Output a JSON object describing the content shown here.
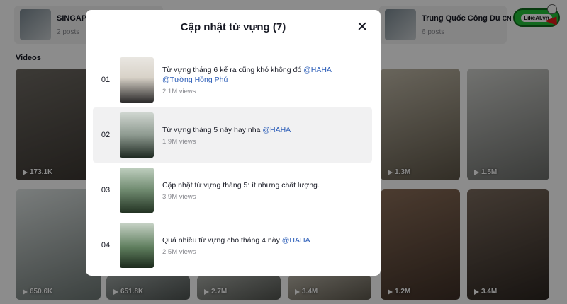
{
  "background": {
    "playlists": [
      {
        "name": "SINGAPO",
        "suffix": "",
        "count": "2 posts"
      },
      {
        "name": "Trung Quốc Công Du",
        "suffix": "CN",
        "count": "6 posts"
      }
    ],
    "logo_text": "LikeAI.vn",
    "videos_heading": "Videos",
    "videos": [
      {
        "views": "173.1K"
      },
      {
        "views": "1.3M"
      },
      {
        "views": "1.5M"
      },
      {
        "views": "650.6K"
      },
      {
        "views": "651.8K"
      },
      {
        "views": "2.7M"
      },
      {
        "views": "3.4M"
      },
      {
        "views": "1.2M"
      },
      {
        "views": "3.4M"
      }
    ]
  },
  "modal": {
    "title": "Cập nhật từ vựng (7)",
    "items": [
      {
        "index": "01",
        "title": "Từ vựng tháng 6 kể ra cũng khó không đó ",
        "mention1": "@HAHA",
        "mention2": "@Tường Hồng Phú",
        "views": "2.1M views"
      },
      {
        "index": "02",
        "title": "Từ vựng tháng 5 này hay nha ",
        "mention1": "@HAHA",
        "mention2": "",
        "views": "1.9M views"
      },
      {
        "index": "03",
        "title": "Cập nhật từ vựng tháng 5: ít nhưng chất lượng.",
        "mention1": "",
        "mention2": "",
        "views": "3.9M views"
      },
      {
        "index": "04",
        "title": "Quá nhiều từ vựng cho tháng 4 này ",
        "mention1": "@HAHA",
        "mention2": "",
        "views": "2.5M views"
      }
    ]
  },
  "colors": {
    "mention": "#2b5db8",
    "text": "#161823",
    "muted": "#8a8b91"
  }
}
